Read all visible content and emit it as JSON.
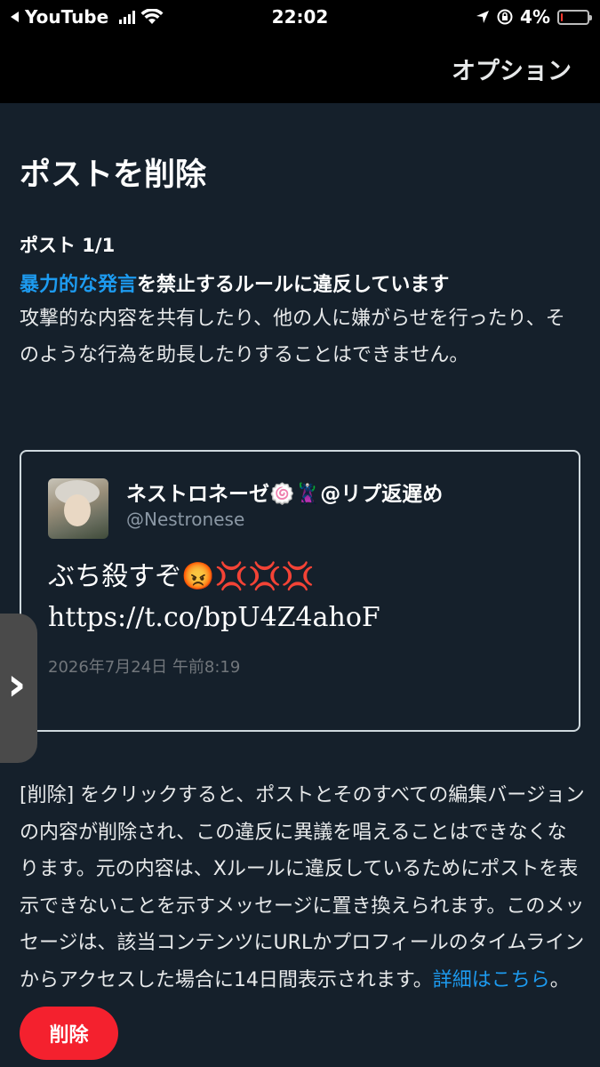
{
  "status_bar": {
    "back_app": "YouTube",
    "time": "22:02",
    "battery_percent": "4%",
    "battery_level": 0.04,
    "icons": [
      "back-arrow-icon",
      "signal-icon",
      "wifi-icon",
      "location-icon",
      "orientation-lock-icon",
      "battery-icon"
    ]
  },
  "nav": {
    "options_label": "オプション"
  },
  "page": {
    "title": "ポストを削除",
    "post_count": "ポスト 1/1",
    "rule_link": "暴力的な発言",
    "rule_rest": "を禁止するルールに違反しています",
    "rule_description": "攻撃的な内容を共有したり、他の人に嫌がらせを行ったり、そのような行為を助長したりすることはできません。"
  },
  "tweet": {
    "display_name": "ネストロネーゼ🍥🦹@リプ返遅め",
    "handle": "@Nestronese",
    "text_line1": "ぶち殺すぞ😡💢💢💢",
    "text_line2": "https://t.co/bpU4Z4ahoF",
    "timestamp": "2026年7月24日 午前8:19"
  },
  "footer": {
    "text": "[削除] をクリックすると、ポストとそのすべての編集バージョンの内容が削除され、この違反に異議を唱えることはできなくなります。元の内容は、Xルールに違反しているためにポストを表示できないことを示すメッセージに置き換えられます。このメッセージは、該当コンテンツにURLかプロフィールのタイムラインからアクセスした場合に14日間表示されます。",
    "more_link": "詳細はこちら",
    "trailing": "。"
  },
  "actions": {
    "delete_label": "削除"
  },
  "colors": {
    "background": "#15202b",
    "link": "#1d9bf0",
    "delete": "#f4212e"
  }
}
